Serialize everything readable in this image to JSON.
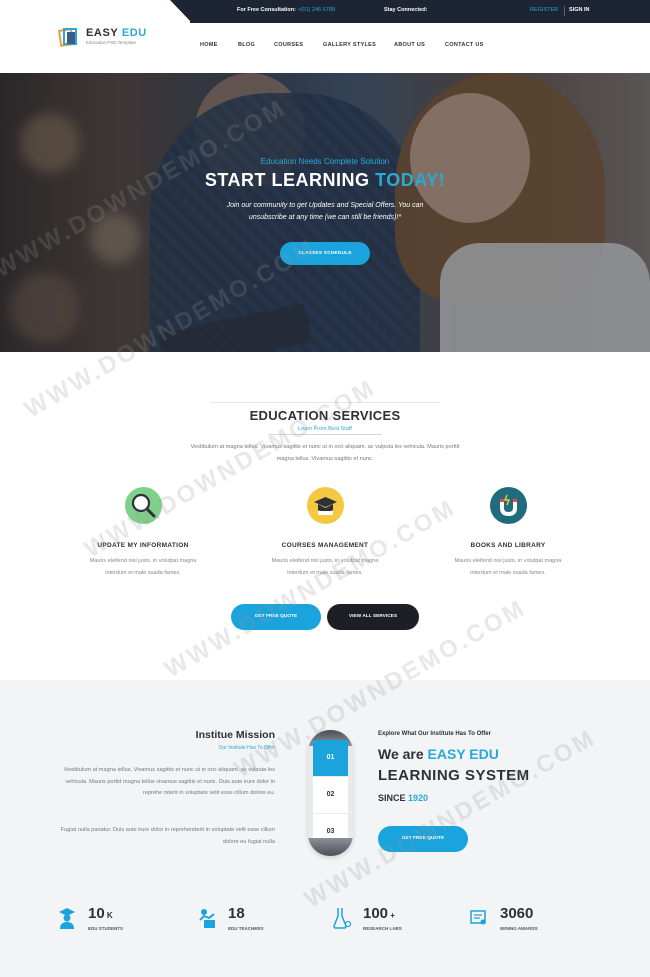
{
  "topbar": {
    "consult_label": "For Free Consultation:",
    "consult_phone": "+(01) 245 6789",
    "connected_label": "Stay Connected:",
    "register": "REGISTER",
    "signin": "SIGN IN"
  },
  "logo": {
    "title_a": "EASY ",
    "title_b": "EDU",
    "subtitle": "Education PSD Template"
  },
  "nav": [
    "HOME",
    "BLOG",
    "COURSES",
    "GALLERY STYLES",
    "ABOUT US",
    "CONTACT US"
  ],
  "hero": {
    "tagline": "Education Needs Complete Solution",
    "title_a": "START LEARNING ",
    "title_b": "TODAY!",
    "text": "Join our community to get Updates and Special Offers. You can unsubscribe at any time (we can still be friends)!*",
    "button": "CLASSES SCHEDULE"
  },
  "services": {
    "title": "EDUCATION SERVICES",
    "subtitle": "Learn From Best Staff",
    "description": "Vestibulum at magna tellus. Vivamus sagittis et nunc ut in orci aliquam. ac vulputa les vehicula. Mauris porttit magna tellus. Vivamus sagittis et nunc.",
    "items": [
      {
        "name": "UPDATE MY INFORMATION",
        "text": "Mauris eleifend nisi justo, in volutpat magna interdum et male suada fames."
      },
      {
        "name": "COURSES MANAGEMENT",
        "text": "Mauris eleifend nisi justo, in volutpat magna interdum et male suada fames."
      },
      {
        "name": "BOOKS AND LIBRARY",
        "text": "Mauris eleifend nisi justo, in volutpat magna interdum et male suada fames."
      }
    ],
    "btn_quote": "GET FREE QUOTE",
    "btn_services": "VIEW ALL SERVICES"
  },
  "mission": {
    "title": "Institue Mission",
    "subtitle": "Our Institute Has To Offer",
    "p1": "Vestibulum at magna tellus. Vivamus sagittis et nunc ut in orci aliquam. ac vulputa les vehicula. Mauris portid magna tellus vivamus sagittis et nunc. Duis aute irure dolor in reprehe nderit in voluptate velit esse cillum dolore eu.",
    "p2": "Fugiat nulla pariatur. Duis aute irure dolor in reprehenderit in voluptate velit esse cillum dolore eu fugiat nulla",
    "steps": [
      "01",
      "02",
      "03"
    ],
    "explore": "Explore What Our Institute Has To Offer",
    "h1_a": "We are ",
    "h1_b": "EASY EDU",
    "h2": "LEARNING SYSTEM",
    "since_a": "SINCE ",
    "since_b": "1920",
    "button": "GET FREE QUOTE"
  },
  "stats": [
    {
      "num": "10",
      "unit": " K",
      "label": "EDU STUDENTS"
    },
    {
      "num": "18",
      "unit": "",
      "label": "EDU TEACHERS"
    },
    {
      "num": "100",
      "unit": " +",
      "label": "RESEARCH LABS"
    },
    {
      "num": "3060",
      "unit": "",
      "label": "WINING AWARDS"
    }
  ],
  "watermark": "WWW.DOWNDEMO.COM",
  "colors": {
    "accent": "#2aa8d8",
    "dark": "#1d2433",
    "button": "#1aa3dc"
  }
}
